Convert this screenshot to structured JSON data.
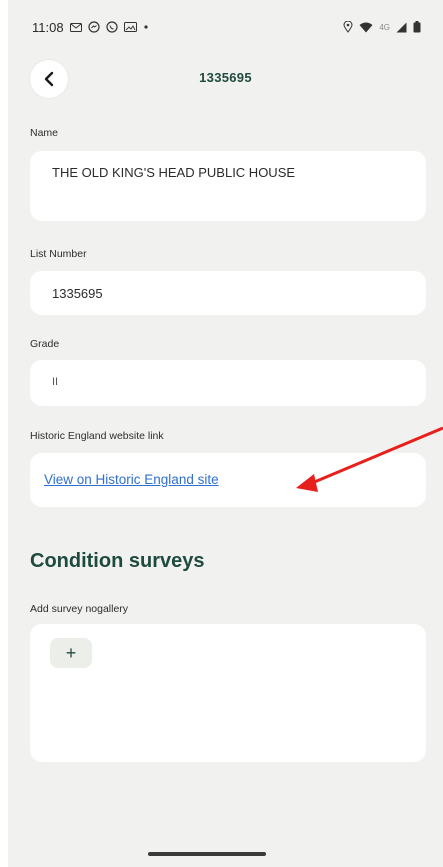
{
  "status_bar": {
    "time": "11:08",
    "left_icons": [
      "gmail-icon",
      "messenger-icon",
      "whatsapp-icon",
      "gallery-icon",
      "dot-icon"
    ],
    "right_icons": [
      "location-icon",
      "wifi-icon",
      "signal-icon",
      "battery-icon"
    ],
    "network_label": "4G"
  },
  "top_bar": {
    "title": "1335695"
  },
  "fields": {
    "name": {
      "label": "Name",
      "value": "THE OLD KING'S HEAD PUBLIC HOUSE"
    },
    "list_number": {
      "label": "List Number",
      "value": "1335695"
    },
    "grade": {
      "label": "Grade",
      "value": "II"
    },
    "website": {
      "label": "Historic England website link",
      "link_text": "View on Historic England site"
    }
  },
  "condition_surveys": {
    "heading": "Condition surveys",
    "add_label": "Add survey nogallery",
    "add_button_label": "+"
  },
  "colors": {
    "background": "#f1f2ef",
    "card": "#ffffff",
    "accent_dark_green": "#1f4a3f",
    "link_blue": "#2f6fd0",
    "annotation_arrow": "#e8201c"
  }
}
